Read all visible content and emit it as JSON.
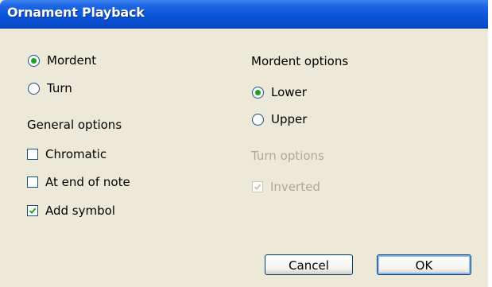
{
  "window": {
    "title": "Ornament Playback"
  },
  "ornament_type": {
    "options": [
      {
        "label": "Mordent",
        "checked": true
      },
      {
        "label": "Turn",
        "checked": false
      }
    ]
  },
  "general_options": {
    "heading": "General options",
    "items": [
      {
        "label": "Chromatic",
        "checked": false
      },
      {
        "label": "At end of note",
        "checked": false
      },
      {
        "label": "Add symbol",
        "checked": true
      }
    ]
  },
  "mordent_options": {
    "heading": "Mordent options",
    "options": [
      {
        "label": "Lower",
        "checked": true
      },
      {
        "label": "Upper",
        "checked": false
      }
    ]
  },
  "turn_options": {
    "heading": "Turn options",
    "enabled": false,
    "items": [
      {
        "label": "Inverted",
        "checked": true,
        "enabled": false
      }
    ]
  },
  "buttons": {
    "cancel": "Cancel",
    "ok": "OK"
  },
  "colors": {
    "titlebar": "#0a55da",
    "dialog_bg": "#ece9d8",
    "radio_dot": "#21a121",
    "disabled_text": "#aca899"
  }
}
